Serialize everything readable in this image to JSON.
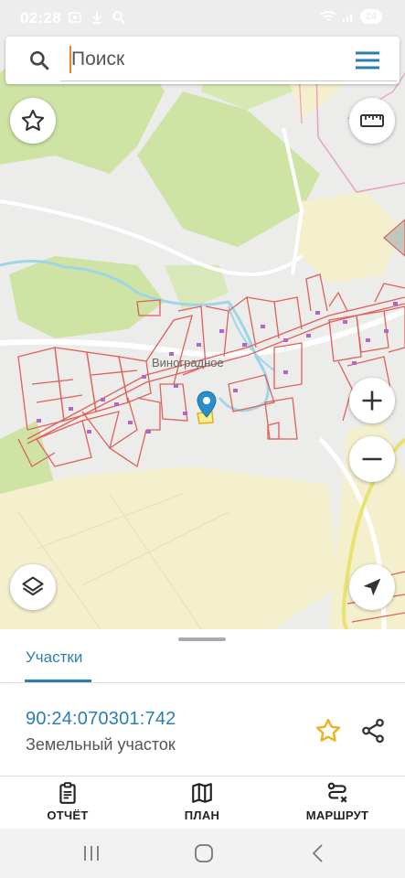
{
  "status_bar": {
    "time": "02:28",
    "battery": "24"
  },
  "search": {
    "placeholder": "Поиск"
  },
  "map": {
    "village_label": "Виноградное",
    "icons": {
      "favorites": "star-icon",
      "ruler": "ruler-icon",
      "zoom_in": "plus-icon",
      "zoom_out": "minus-icon",
      "layers": "layers-icon",
      "location": "navigation-arrow-icon",
      "marker": "map-pin-icon"
    }
  },
  "sheet": {
    "tab": "Участки",
    "parcel_number": "90:24:070301:742",
    "parcel_type": "Земельный участок"
  },
  "nav": {
    "report": "ОТЧЁТ",
    "plan": "ПЛАН",
    "route": "МАРШРУТ"
  },
  "colors": {
    "accent": "#2b7fb0",
    "parcel_border": "#e0605a",
    "star": "#e8b624",
    "field_green": "#cfe3a4",
    "field_yellow": "#f4efcc"
  }
}
